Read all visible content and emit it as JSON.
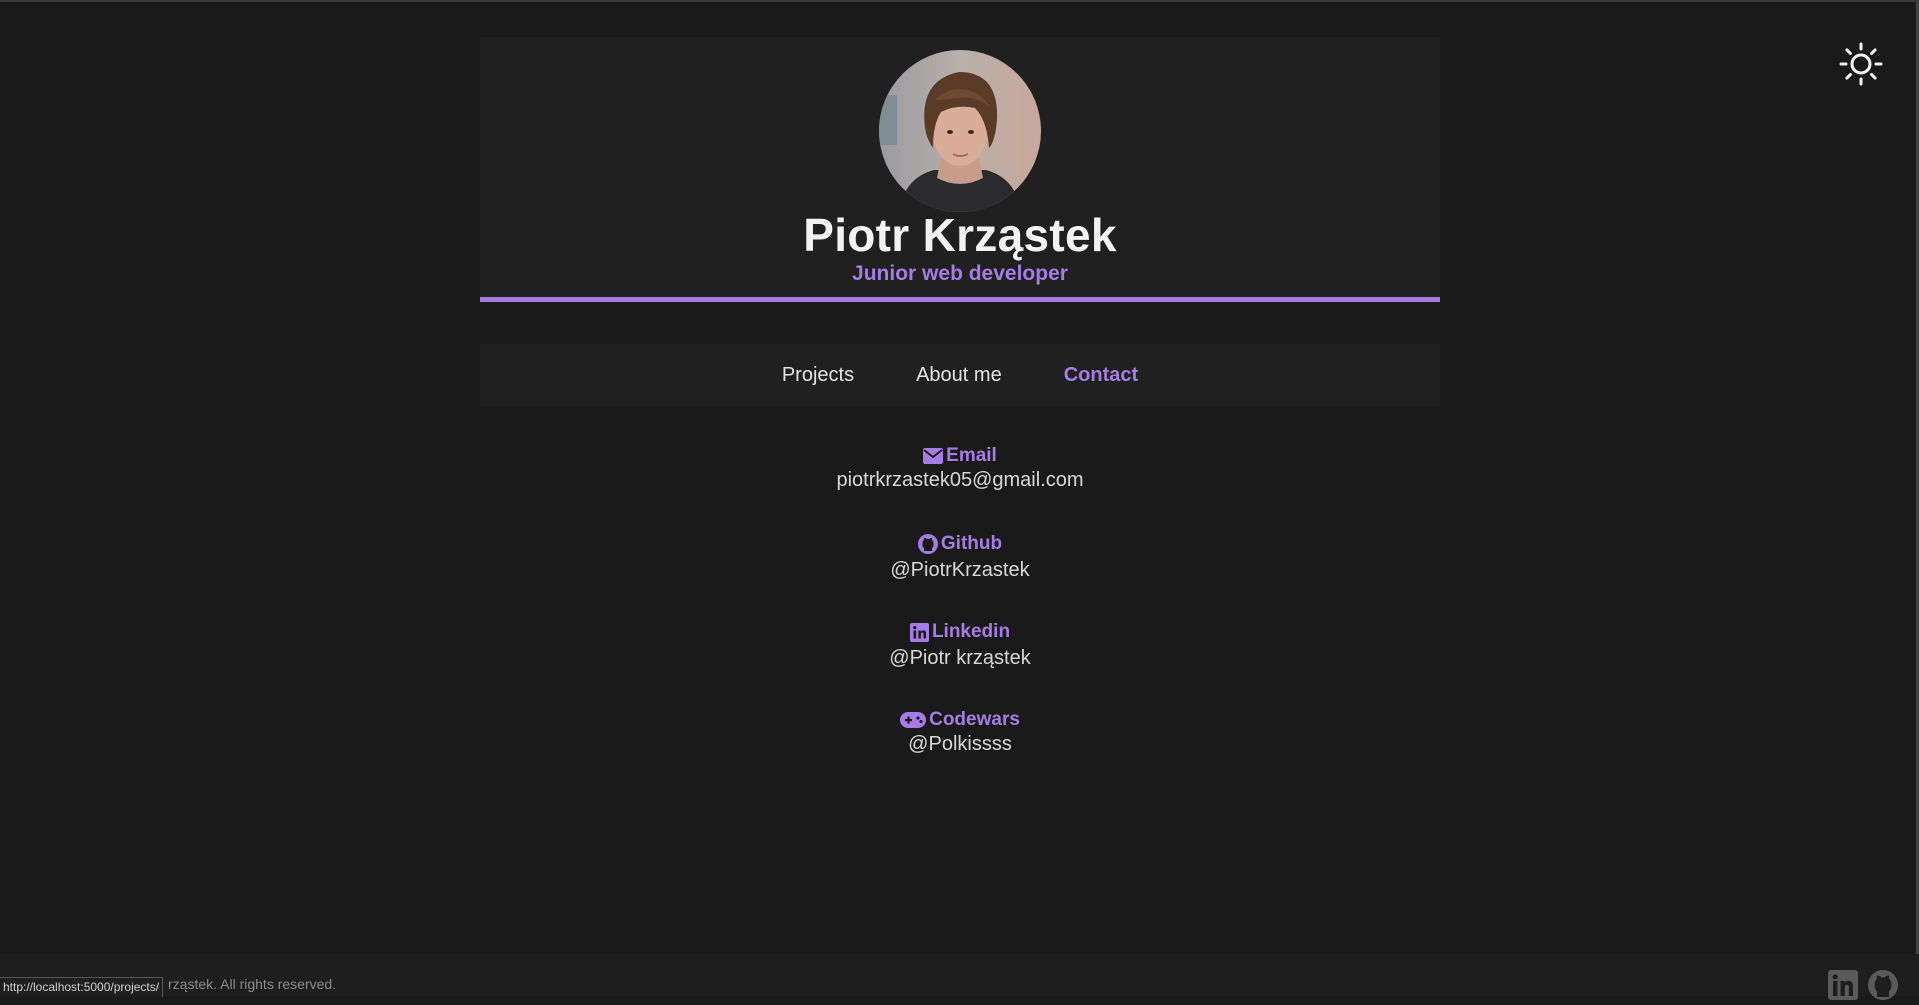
{
  "header": {
    "name": "Piotr Krząstek",
    "role": "Junior web developer"
  },
  "theme_toggle": {
    "icon": "sun-icon"
  },
  "nav": {
    "items": [
      {
        "label": "Projects",
        "active": false
      },
      {
        "label": "About me",
        "active": false
      },
      {
        "label": "Contact",
        "active": true
      }
    ]
  },
  "contacts": [
    {
      "icon": "envelope-icon",
      "label": "Email",
      "value": "piotrkrzastek05@gmail.com"
    },
    {
      "icon": "github-icon",
      "label": "Github",
      "value": "@PiotrKrzastek"
    },
    {
      "icon": "linkedin-icon",
      "label": "Linkedin",
      "value": "@Piotr krząstek"
    },
    {
      "icon": "gamepad-icon",
      "label": "Codewars",
      "value": "@Polkissss"
    }
  ],
  "footer": {
    "copyright_visible": "rząstek. All rights reserved.",
    "status_url": "http://localhost:5000/projects/",
    "icons": [
      "linkedin-icon",
      "github-icon"
    ]
  },
  "colors": {
    "accent": "#a67ce4",
    "background": "#1a1a1a",
    "panel": "#202020"
  }
}
